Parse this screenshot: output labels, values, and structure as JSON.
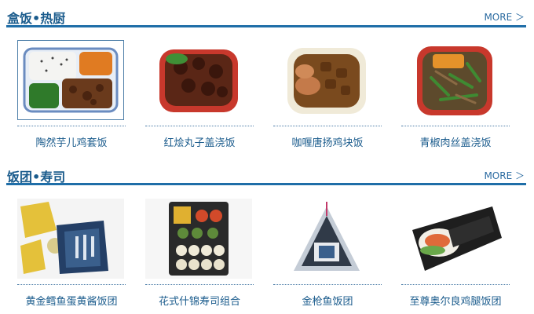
{
  "sections": [
    {
      "title": "盒饭•热厨",
      "more": "MORE ＞",
      "items": [
        {
          "caption": "陶然芋儿鸡套饭"
        },
        {
          "caption": "红烩丸子盖浇饭"
        },
        {
          "caption": "咖喱唐扬鸡块饭"
        },
        {
          "caption": "青椒肉丝盖浇饭"
        }
      ]
    },
    {
      "title": "饭团•寿司",
      "more": "MORE ＞",
      "items": [
        {
          "caption": "黄金鳕鱼蛋黄酱饭团"
        },
        {
          "caption": "花式什锦寿司组合"
        },
        {
          "caption": "金枪鱼饭团"
        },
        {
          "caption": "至尊奥尔良鸡腿饭团"
        }
      ]
    }
  ]
}
